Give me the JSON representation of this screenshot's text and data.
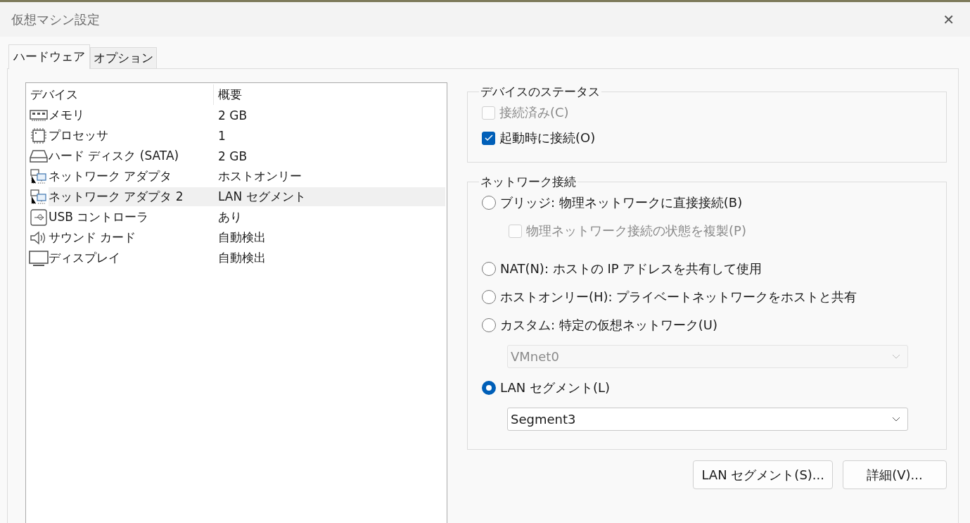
{
  "window": {
    "title": "仮想マシン設定",
    "close": "✕"
  },
  "tabs": [
    {
      "label": "ハードウェア",
      "selected": true
    },
    {
      "label": "オプション",
      "selected": false
    }
  ],
  "devices": {
    "columns": [
      "デバイス",
      "概要"
    ],
    "rows": [
      {
        "kind": "memory",
        "name": "メモリ",
        "summary": "2 GB",
        "selected": false
      },
      {
        "kind": "cpu",
        "name": "プロセッサ",
        "summary": "1",
        "selected": false
      },
      {
        "kind": "disk",
        "name": "ハード ディスク (SATA)",
        "summary": "2 GB",
        "selected": false
      },
      {
        "kind": "network",
        "name": "ネットワーク アダプタ",
        "summary": "ホストオンリー",
        "selected": false
      },
      {
        "kind": "network",
        "name": "ネットワーク アダプタ 2",
        "summary": "LAN セグメント",
        "selected": true
      },
      {
        "kind": "usb",
        "name": "USB コントローラ",
        "summary": "あり",
        "selected": false
      },
      {
        "kind": "sound",
        "name": "サウンド カード",
        "summary": "自動検出",
        "selected": false
      },
      {
        "kind": "display",
        "name": "ディスプレイ",
        "summary": "自動検出",
        "selected": false
      }
    ]
  },
  "device_status": {
    "title": "デバイスのステータス",
    "options": [
      {
        "label": "接続済み(C)",
        "checked": false,
        "disabled": true
      },
      {
        "label": "起動時に接続(O)",
        "checked": true,
        "disabled": false
      }
    ]
  },
  "network": {
    "title": "ネットワーク接続",
    "items": [
      {
        "kind": "radio",
        "label": "ブリッジ: 物理ネットワークに直接接続(B)",
        "selected": false
      },
      {
        "kind": "checkbox",
        "label": "物理ネットワーク接続の状態を複製(P)",
        "checked": false,
        "disabled": true
      },
      {
        "kind": "radio",
        "label": "NAT(N): ホストの IP アドレスを共有して使用",
        "selected": false
      },
      {
        "kind": "radio",
        "label": "ホストオンリー(H): プライベートネットワークをホストと共有",
        "selected": false
      },
      {
        "kind": "radio",
        "label": "カスタム: 特定の仮想ネットワーク(U)",
        "selected": false
      },
      {
        "kind": "dropdown",
        "value": "VMnet0",
        "disabled": true
      },
      {
        "kind": "radio",
        "label": "LAN セグメント(L)",
        "selected": true
      },
      {
        "kind": "dropdown",
        "value": "Segment3",
        "disabled": false
      }
    ]
  },
  "buttons": [
    "LAN セグメント(S)...",
    "詳細(V)..."
  ]
}
